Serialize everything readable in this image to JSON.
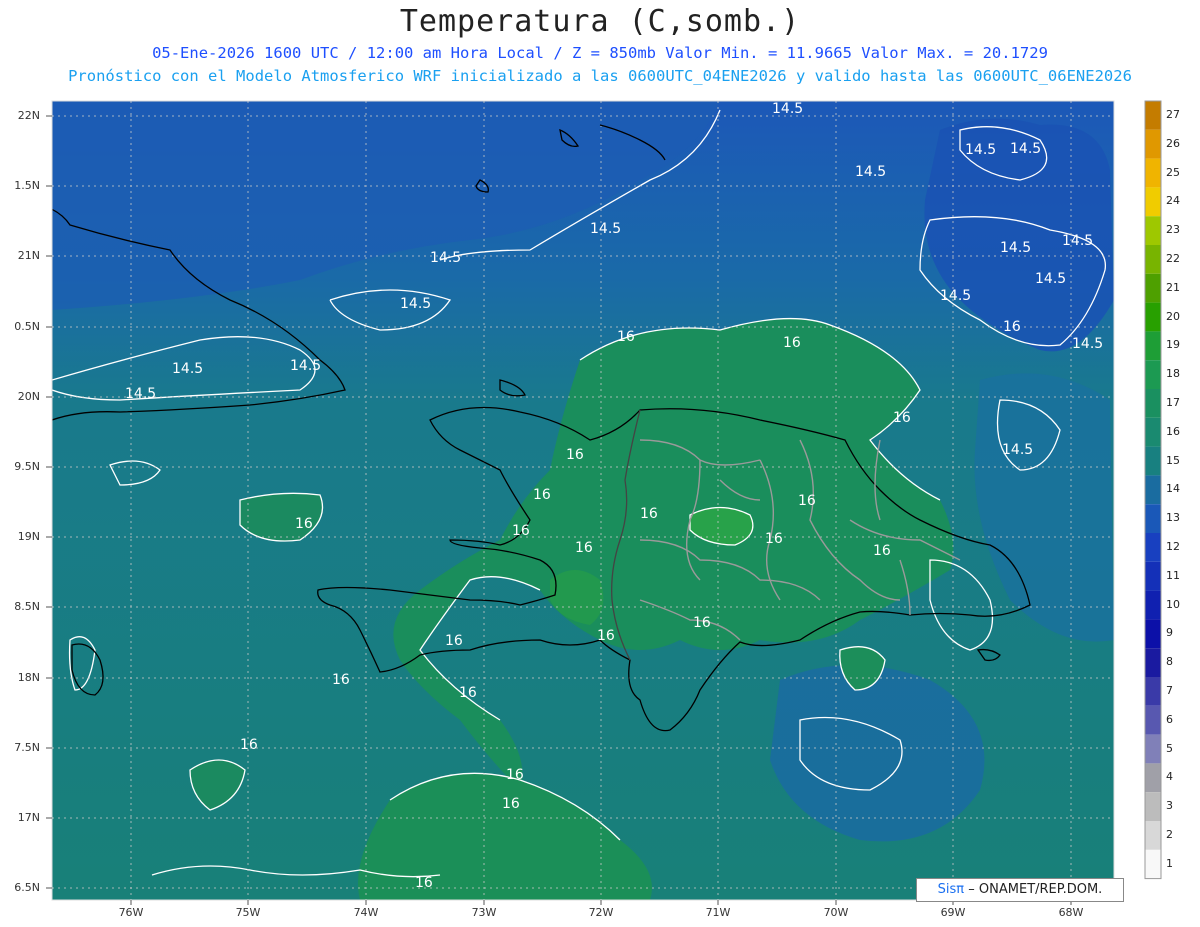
{
  "header": {
    "title": "Temperatura (C,somb.)",
    "line1": "05-Ene-2026  1600 UTC / 12:00 am Hora Local / Z = 850mb   Valor Min. = 11.9665  Valor Max. = 20.1729",
    "line2": "Pronóstico con el Modelo Atmosferico WRF inicializado a las 0600UTC_04ENE2026 y valido hasta las  0600UTC_06ENE2026"
  },
  "axes": {
    "lat_labels": [
      "22N",
      "1.5N",
      "21N",
      "0.5N",
      "20N",
      "9.5N",
      "19N",
      "8.5N",
      "18N",
      "7.5N",
      "17N",
      "6.5N"
    ],
    "lon_labels": [
      "76W",
      "75W",
      "74W",
      "73W",
      "72W",
      "71W",
      "70W",
      "69W",
      "68W"
    ]
  },
  "colorbar": {
    "labels": [
      "27",
      "26",
      "25",
      "24",
      "23",
      "22",
      "21",
      "20",
      "19",
      "18",
      "17",
      "16",
      "15",
      "14",
      "13",
      "12",
      "11",
      "10",
      "9",
      "8",
      "7",
      "6",
      "5",
      "4",
      "3",
      "2",
      "1"
    ],
    "colors": [
      "#c47c00",
      "#e09800",
      "#f0b400",
      "#f0cc00",
      "#9ec800",
      "#78b400",
      "#4ea000",
      "#28a000",
      "#1e9e36",
      "#1c9a52",
      "#1a9060",
      "#1a8a70",
      "#188080",
      "#1a6ca0",
      "#1a58b8",
      "#1840c0",
      "#1430b8",
      "#1020b0",
      "#0c10a8",
      "#1a1aa0",
      "#3a3aa8",
      "#5858b0",
      "#8080b8",
      "#a0a0a8",
      "#bcbcbc",
      "#d8d8d8",
      "#f8f8f8"
    ]
  },
  "contours": {
    "labels_14_5": [
      "14.5",
      "14.5",
      "14.5",
      "14.5",
      "14.5",
      "14.5",
      "14.5",
      "14.5",
      "14.5",
      "14.5",
      "14.5",
      "14.5",
      "14.5",
      "14.5",
      "14.5",
      "14.5"
    ],
    "labels_16": [
      "16",
      "16",
      "16",
      "16",
      "16",
      "16",
      "16",
      "16",
      "16",
      "16",
      "16",
      "16",
      "16",
      "16",
      "16",
      "16",
      "16",
      "16",
      "16",
      "16",
      "16",
      "16"
    ]
  },
  "credit": {
    "sis": "Sisπ",
    "rest": "– ONAMET/REP.DOM."
  }
}
